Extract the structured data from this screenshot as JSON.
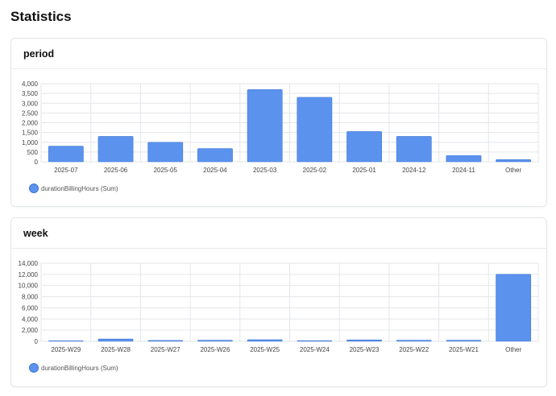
{
  "page": {
    "title": "Statistics"
  },
  "colors": {
    "bar": "#5b92ee",
    "bar_stroke": "#3f78d6",
    "grid": "#e3e6ea",
    "tick": "#444444"
  },
  "charts": [
    {
      "title": "period",
      "legend": "durationBillingHours (Sum)"
    },
    {
      "title": "week",
      "legend": "durationBillingHours (Sum)"
    }
  ],
  "chart_data": [
    {
      "type": "bar",
      "title": "period",
      "categories": [
        "2025-07",
        "2025-06",
        "2025-05",
        "2025-04",
        "2025-03",
        "2025-02",
        "2025-01",
        "2024-12",
        "2024-11",
        "Other"
      ],
      "series": [
        {
          "name": "durationBillingHours (Sum)",
          "values": [
            800,
            1300,
            1000,
            680,
            3700,
            3300,
            1550,
            1300,
            320,
            110
          ]
        }
      ],
      "ylim": [
        0,
        4000
      ],
      "yticks": [
        0,
        500,
        1000,
        1500,
        2000,
        2500,
        3000,
        3500,
        4000
      ],
      "grid": true,
      "legend_position": "bottom-left"
    },
    {
      "type": "bar",
      "title": "week",
      "categories": [
        "2025-W29",
        "2025-W28",
        "2025-W27",
        "2025-W26",
        "2025-W25",
        "2025-W24",
        "2025-W23",
        "2025-W22",
        "2025-W21",
        "Other"
      ],
      "series": [
        {
          "name": "durationBillingHours (Sum)",
          "values": [
            80,
            400,
            150,
            200,
            280,
            100,
            250,
            200,
            200,
            12000
          ]
        }
      ],
      "ylim": [
        0,
        14000
      ],
      "yticks": [
        0,
        2000,
        4000,
        6000,
        8000,
        10000,
        12000,
        14000
      ],
      "grid": true,
      "legend_position": "bottom-left"
    }
  ]
}
